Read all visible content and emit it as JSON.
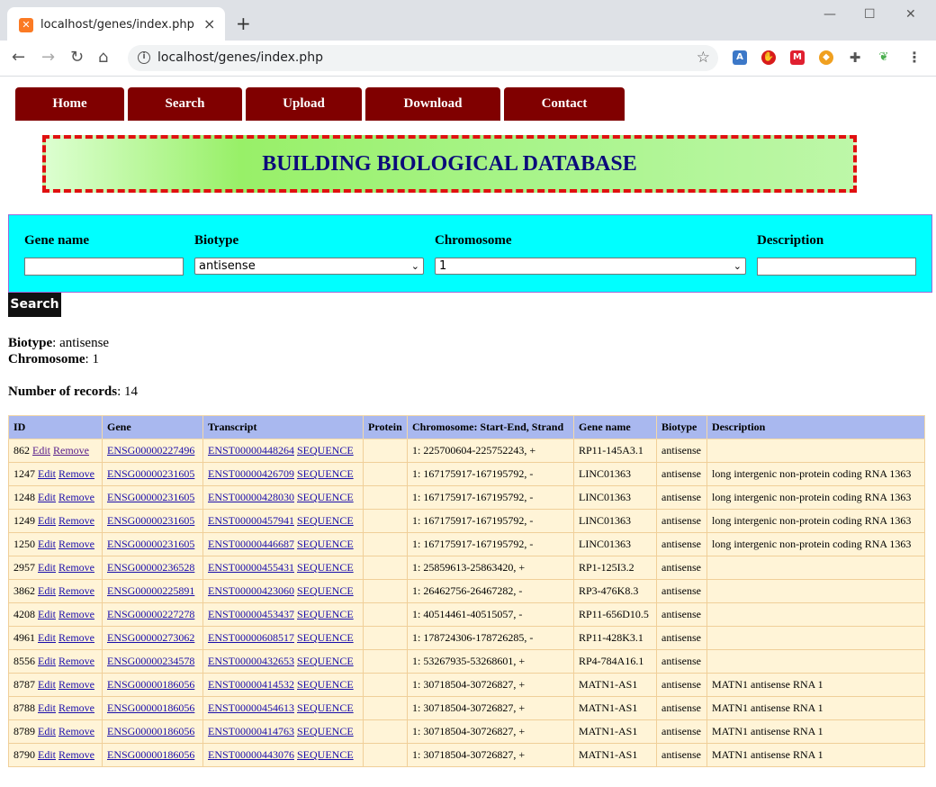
{
  "browser": {
    "tab_title": "localhost/genes/index.php",
    "tab_favicon": "xampp-icon",
    "tab_close": "×",
    "new_tab": "+",
    "url": "localhost/genes/index.php",
    "window_controls": [
      "—",
      "☐",
      "✕"
    ]
  },
  "nav": [
    {
      "label": "Home"
    },
    {
      "label": "Search"
    },
    {
      "label": "Upload"
    },
    {
      "label": "Download"
    },
    {
      "label": "Contact"
    }
  ],
  "banner": {
    "title": "BUILDING BIOLOGICAL DATABASE"
  },
  "filter": {
    "gene_name_label": "Gene name",
    "gene_name_value": "",
    "biotype_label": "Biotype",
    "biotype_value": "antisense",
    "chromosome_label": "Chromosome",
    "chromosome_value": "1",
    "description_label": "Description",
    "description_value": "",
    "search_label": "Search"
  },
  "summary": {
    "biotype_label": "Biotype",
    "biotype_value": ": antisense",
    "chromosome_label": "Chromosome",
    "chromosome_value": ": 1",
    "records_label": "Number of records",
    "records_value": ": 14"
  },
  "table": {
    "columns": [
      "ID",
      "Gene",
      "Transcript",
      "Protein",
      "Chromosome: Start-End, Strand",
      "Gene name",
      "Biotype",
      "Description"
    ],
    "edit_label": "Edit",
    "remove_label": "Remove",
    "sequence_label": "SEQUENCE",
    "rows": [
      {
        "id": "862",
        "gene": "ENSG00000227496",
        "transcript": "ENST00000448264",
        "protein": "",
        "location": "1: 225700604-225752243, +",
        "gene_name": "RP11-145A3.1",
        "biotype": "antisense",
        "description": ""
      },
      {
        "id": "1247",
        "gene": "ENSG00000231605",
        "transcript": "ENST00000426709",
        "protein": "",
        "location": "1: 167175917-167195792, -",
        "gene_name": "LINC01363",
        "biotype": "antisense",
        "description": "long intergenic non-protein coding RNA 1363"
      },
      {
        "id": "1248",
        "gene": "ENSG00000231605",
        "transcript": "ENST00000428030",
        "protein": "",
        "location": "1: 167175917-167195792, -",
        "gene_name": "LINC01363",
        "biotype": "antisense",
        "description": "long intergenic non-protein coding RNA 1363"
      },
      {
        "id": "1249",
        "gene": "ENSG00000231605",
        "transcript": "ENST00000457941",
        "protein": "",
        "location": "1: 167175917-167195792, -",
        "gene_name": "LINC01363",
        "biotype": "antisense",
        "description": "long intergenic non-protein coding RNA 1363"
      },
      {
        "id": "1250",
        "gene": "ENSG00000231605",
        "transcript": "ENST00000446687",
        "protein": "",
        "location": "1: 167175917-167195792, -",
        "gene_name": "LINC01363",
        "biotype": "antisense",
        "description": "long intergenic non-protein coding RNA 1363"
      },
      {
        "id": "2957",
        "gene": "ENSG00000236528",
        "transcript": "ENST00000455431",
        "protein": "",
        "location": "1: 25859613-25863420, +",
        "gene_name": "RP1-125I3.2",
        "biotype": "antisense",
        "description": ""
      },
      {
        "id": "3862",
        "gene": "ENSG00000225891",
        "transcript": "ENST00000423060",
        "protein": "",
        "location": "1: 26462756-26467282, -",
        "gene_name": "RP3-476K8.3",
        "biotype": "antisense",
        "description": ""
      },
      {
        "id": "4208",
        "gene": "ENSG00000227278",
        "transcript": "ENST00000453437",
        "protein": "",
        "location": "1: 40514461-40515057, -",
        "gene_name": "RP11-656D10.5",
        "biotype": "antisense",
        "description": ""
      },
      {
        "id": "4961",
        "gene": "ENSG00000273062",
        "transcript": "ENST00000608517",
        "protein": "",
        "location": "1: 178724306-178726285, -",
        "gene_name": "RP11-428K3.1",
        "biotype": "antisense",
        "description": ""
      },
      {
        "id": "8556",
        "gene": "ENSG00000234578",
        "transcript": "ENST00000432653",
        "protein": "",
        "location": "1: 53267935-53268601, +",
        "gene_name": "RP4-784A16.1",
        "biotype": "antisense",
        "description": ""
      },
      {
        "id": "8787",
        "gene": "ENSG00000186056",
        "transcript": "ENST00000414532",
        "protein": "",
        "location": "1: 30718504-30726827, +",
        "gene_name": "MATN1-AS1",
        "biotype": "antisense",
        "description": "MATN1 antisense RNA 1"
      },
      {
        "id": "8788",
        "gene": "ENSG00000186056",
        "transcript": "ENST00000454613",
        "protein": "",
        "location": "1: 30718504-30726827, +",
        "gene_name": "MATN1-AS1",
        "biotype": "antisense",
        "description": "MATN1 antisense RNA 1"
      },
      {
        "id": "8789",
        "gene": "ENSG00000186056",
        "transcript": "ENST00000414763",
        "protein": "",
        "location": "1: 30718504-30726827, +",
        "gene_name": "MATN1-AS1",
        "biotype": "antisense",
        "description": "MATN1 antisense RNA 1"
      },
      {
        "id": "8790",
        "gene": "ENSG00000186056",
        "transcript": "ENST00000443076",
        "protein": "",
        "location": "1: 30718504-30726827, +",
        "gene_name": "MATN1-AS1",
        "biotype": "antisense",
        "description": "MATN1 antisense RNA 1"
      }
    ]
  },
  "colors": {
    "nav_bg": "#800000",
    "banner_border": "#e01010",
    "banner_text": "#0b0b7a",
    "filter_bg": "#00ffff",
    "table_header_bg": "#a9b8ef",
    "table_row_bg": "#fff4d7"
  }
}
